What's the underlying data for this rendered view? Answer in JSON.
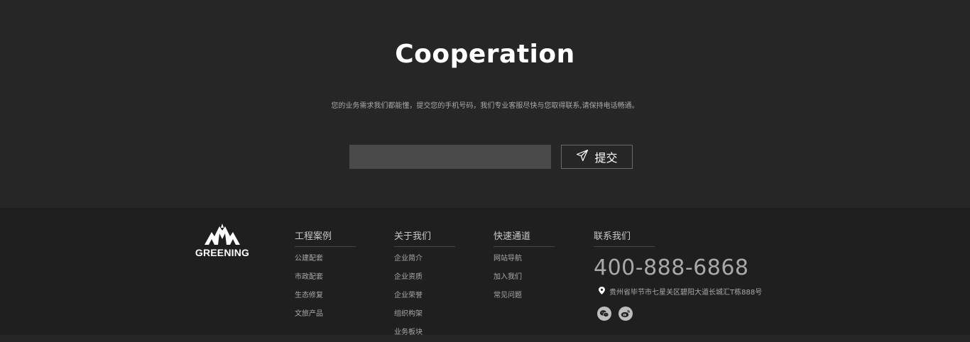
{
  "cooperation": {
    "title": "Cooperation",
    "subtitle": "您的业务需求我们都能懂，提交您的手机号码，我们专业客服尽快与您取得联系,请保持电话畅通。",
    "input_value": "",
    "submit_label": "提交"
  },
  "footer": {
    "logo_text": "GREENING",
    "columns": [
      {
        "title": "工程案例",
        "items": [
          "公建配套",
          "市政配套",
          "生态修复",
          "文旅产品"
        ]
      },
      {
        "title": "关于我们",
        "items": [
          "企业简介",
          "企业资质",
          "企业荣誉",
          "组织构架",
          "业务板块"
        ]
      },
      {
        "title": "快速通道",
        "items": [
          "网站导航",
          "加入我们",
          "常见问题"
        ]
      }
    ],
    "contact": {
      "title": "联系我们",
      "hotline": "400-888-6868",
      "address": "贵州省毕节市七星关区碧阳大道长城汇T栋888号",
      "socials": [
        "wechat-icon",
        "weibo-icon"
      ]
    }
  },
  "colors": {
    "background": "#262626",
    "footer_background": "#1f1f1f",
    "input_background": "#4a4a4a",
    "text_muted": "#a9a9a9"
  }
}
